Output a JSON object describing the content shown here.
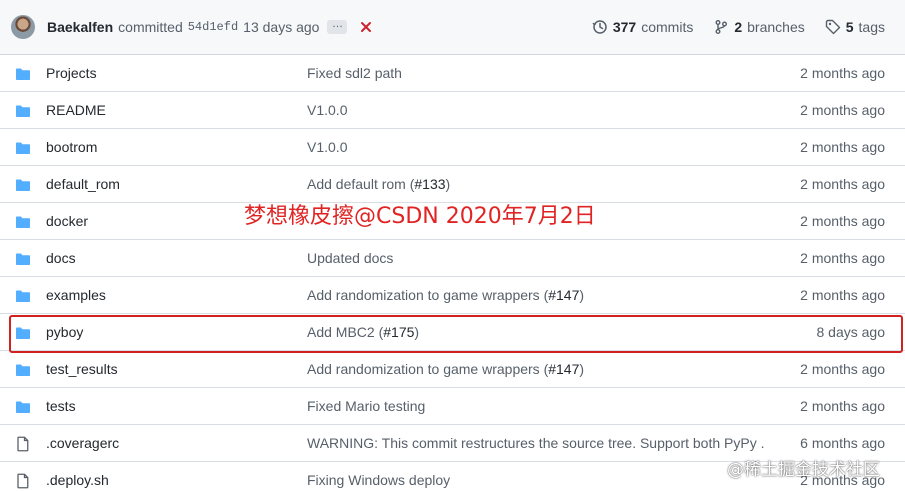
{
  "colors": {
    "folder": "#54aeff",
    "fail": "#cf222e",
    "highlight": "#d0221e",
    "overlay": "#e02424"
  },
  "commit_bar": {
    "author": "Baekalfen",
    "committed": "committed",
    "sha": "54d1efd",
    "ago": "13 days ago",
    "ellipsis": "…",
    "status_icon": "x-icon",
    "commits_count": "377",
    "commits_label": "commits",
    "branches_count": "2",
    "branches_label": "branches",
    "tags_count": "5",
    "tags_label": "tags"
  },
  "files": [
    {
      "type": "folder",
      "name": "Projects",
      "message": "Fixed sdl2 path",
      "pr": "",
      "message_end": "",
      "time": "2 months ago"
    },
    {
      "type": "folder",
      "name": "README",
      "message": "V1.0.0",
      "pr": "",
      "message_end": "",
      "time": "2 months ago"
    },
    {
      "type": "folder",
      "name": "bootrom",
      "message": "V1.0.0",
      "pr": "",
      "message_end": "",
      "time": "2 months ago"
    },
    {
      "type": "folder",
      "name": "default_rom",
      "message": "Add default rom (",
      "pr": "#133",
      "message_end": ")",
      "time": "2 months ago"
    },
    {
      "type": "folder",
      "name": "docker",
      "message": "",
      "pr": "",
      "message_end": "",
      "time": "2 months ago"
    },
    {
      "type": "folder",
      "name": "docs",
      "message": "Updated docs",
      "pr": "",
      "message_end": "",
      "time": "2 months ago"
    },
    {
      "type": "folder",
      "name": "examples",
      "message": "Add randomization to game wrappers (",
      "pr": "#147",
      "message_end": ")",
      "time": "2 months ago"
    },
    {
      "type": "folder",
      "name": "pyboy",
      "message": "Add MBC2 (",
      "pr": "#175",
      "message_end": ")",
      "time": "8 days ago"
    },
    {
      "type": "folder",
      "name": "test_results",
      "message": "Add randomization to game wrappers (",
      "pr": "#147",
      "message_end": ")",
      "time": "2 months ago"
    },
    {
      "type": "folder",
      "name": "tests",
      "message": "Fixed Mario testing",
      "pr": "",
      "message_end": "",
      "time": "2 months ago"
    },
    {
      "type": "file",
      "name": ".coveragerc",
      "message": "WARNING: This commit restructures the source tree. Support both PyPy ...",
      "pr": "",
      "message_end": "",
      "time": "6 months ago"
    },
    {
      "type": "file",
      "name": ".deploy.sh",
      "message": "Fixing Windows deploy",
      "pr": "",
      "message_end": "",
      "time": "2 months ago"
    }
  ],
  "overlay_text": "梦想橡皮擦@CSDN  2020年7月2日",
  "watermark": "@稀土掘金技术社区"
}
